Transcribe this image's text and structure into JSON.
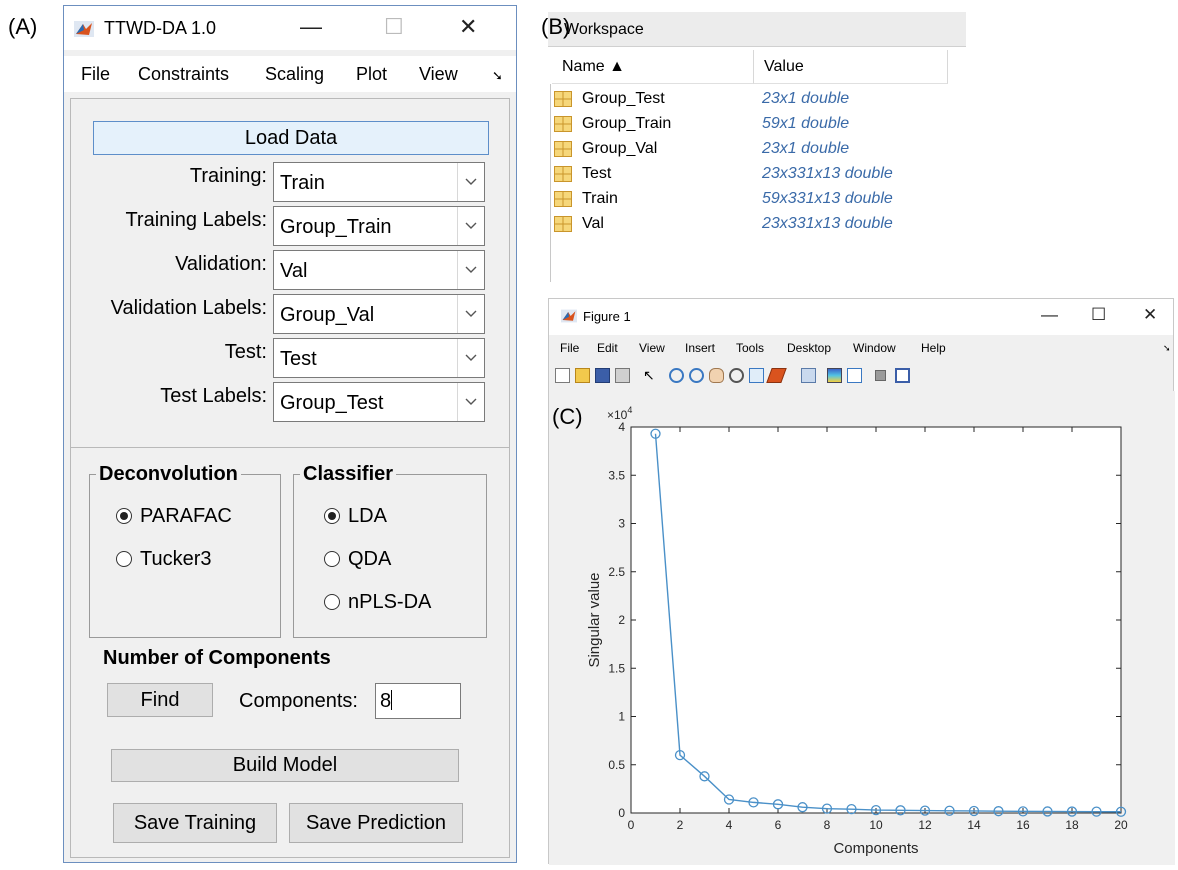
{
  "panel_labels": {
    "a": "(A)",
    "b": "(B)",
    "c": "(C)"
  },
  "app": {
    "title": "TTWD-DA 1.0",
    "window_controls": {
      "minimize": "—",
      "maximize": "☐",
      "close": "✕"
    },
    "menu": [
      "File",
      "Constraints",
      "Scaling",
      "Plot",
      "View"
    ],
    "menu_overflow": "➘",
    "load_data_label": "Load Data",
    "fields": [
      {
        "label": "Training:",
        "value": "Train"
      },
      {
        "label": "Training Labels:",
        "value": "Group_Train"
      },
      {
        "label": "Validation:",
        "value": "Val"
      },
      {
        "label": "Validation Labels:",
        "value": "Group_Val"
      },
      {
        "label": "Test:",
        "value": "Test"
      },
      {
        "label": "Test Labels:",
        "value": "Group_Test"
      }
    ],
    "deconvolution": {
      "title": "Deconvolution",
      "options": [
        {
          "label": "PARAFAC",
          "selected": true
        },
        {
          "label": "Tucker3",
          "selected": false
        }
      ]
    },
    "classifier": {
      "title": "Classifier",
      "options": [
        {
          "label": "LDA",
          "selected": true
        },
        {
          "label": "QDA",
          "selected": false
        },
        {
          "label": "nPLS-DA",
          "selected": false
        }
      ]
    },
    "components_heading": "Number of Components",
    "find_label": "Find",
    "components_label": "Components:",
    "components_value": "8",
    "build_model_label": "Build Model",
    "save_training_label": "Save Training",
    "save_prediction_label": "Save Prediction"
  },
  "workspace": {
    "title": "Workspace",
    "columns": {
      "name": "Name ▲",
      "value": "Value"
    },
    "rows": [
      {
        "name": "Group_Test",
        "value": "23x1 double"
      },
      {
        "name": "Group_Train",
        "value": "59x1 double"
      },
      {
        "name": "Group_Val",
        "value": "23x1 double"
      },
      {
        "name": "Test",
        "value": "23x331x13 double"
      },
      {
        "name": "Train",
        "value": "59x331x13 double"
      },
      {
        "name": "Val",
        "value": "23x331x13 double"
      }
    ]
  },
  "figure": {
    "title": "Figure 1",
    "window_controls": {
      "minimize": "—",
      "maximize": "☐",
      "close": "✕"
    },
    "menu": [
      "File",
      "Edit",
      "View",
      "Insert",
      "Tools",
      "Desktop",
      "Window",
      "Help"
    ],
    "menu_overflow": "➘",
    "toolbar_icons": [
      "new-figure-icon",
      "open-file-icon",
      "save-icon",
      "print-icon",
      "pointer-icon",
      "zoom-in-icon",
      "zoom-out-icon",
      "pan-icon",
      "rotate-icon",
      "data-cursor-icon",
      "brush-icon",
      "link-plot-icon",
      "colorbar-icon",
      "legend-icon",
      "hide-plot-tools-icon",
      "show-plot-tools-icon"
    ]
  },
  "chart_data": {
    "type": "line",
    "title": "",
    "xlabel": "Components",
    "ylabel": "Singular value",
    "y_exponent_label": "×10",
    "y_exponent_power": "4",
    "xlim": [
      0,
      20
    ],
    "ylim": [
      0,
      40000
    ],
    "x_ticks": [
      "0",
      "2",
      "4",
      "6",
      "8",
      "10",
      "12",
      "14",
      "16",
      "18",
      "20"
    ],
    "y_ticks": [
      "0",
      "0.5",
      "1",
      "1.5",
      "2",
      "2.5",
      "3",
      "3.5",
      "4"
    ],
    "line_color": "#4a90c8",
    "marker": "circle",
    "grid": false,
    "x": [
      1,
      2,
      3,
      4,
      5,
      6,
      7,
      8,
      9,
      10,
      11,
      12,
      13,
      14,
      15,
      16,
      17,
      18,
      19,
      20
    ],
    "y": [
      39300,
      6000,
      3800,
      1400,
      1100,
      900,
      600,
      450,
      400,
      300,
      280,
      250,
      230,
      210,
      190,
      170,
      160,
      150,
      140,
      130
    ]
  }
}
